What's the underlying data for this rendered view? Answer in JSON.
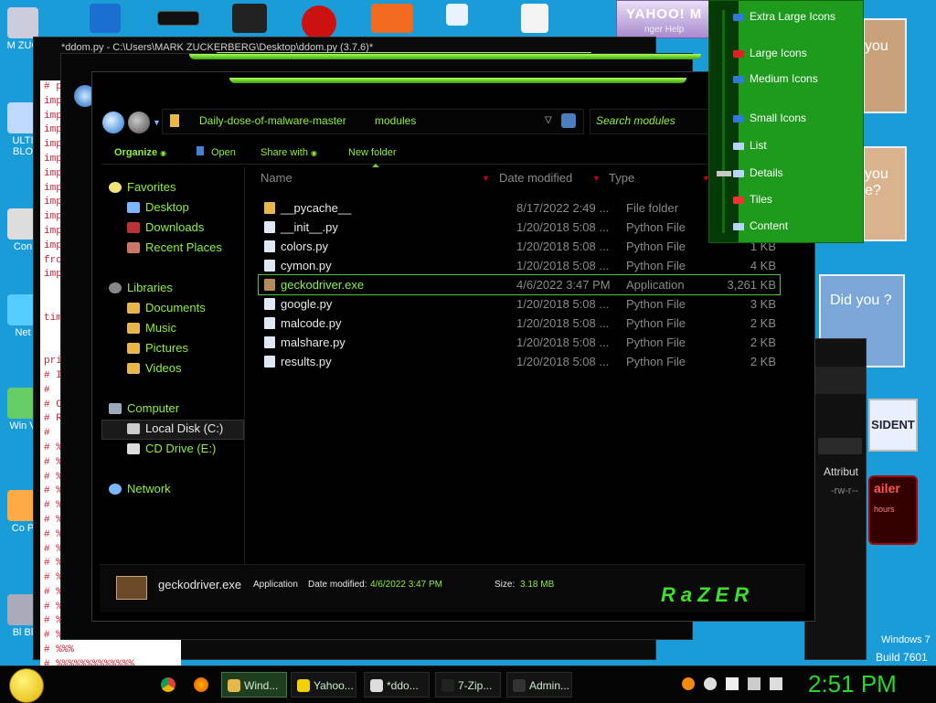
{
  "desktop": {
    "icons": [
      {
        "label": "M ZUC",
        "color": "#ccd"
      },
      {
        "label": "ULTI BLO",
        "color": "#bfd8ff"
      },
      {
        "label": "Con",
        "color": "#ddd"
      },
      {
        "label": "Net",
        "color": "#5cf"
      },
      {
        "label": "Win V",
        "color": "#6c6"
      },
      {
        "label": "Co P",
        "color": "#fa4"
      },
      {
        "label": "Bl Bl",
        "color": "#aab"
      }
    ]
  },
  "code_window": {
    "title": "*ddom.py - C:\\Users\\MARK ZUCKERBERG\\Desktop\\ddom.py (3.7.6)*",
    "lines": [
      "# p",
      "imp",
      "imp",
      "imp",
      "imp",
      "imp",
      "imp",
      "imp",
      "imp",
      "imp",
      "imp",
      "imp",
      "fro",
      "imp",
      "",
      "",
      "tim",
      "",
      "",
      "pri",
      "# I",
      "#",
      "# C",
      "# R",
      "#",
      "# %",
      "# %",
      "# %",
      "# %",
      "# %",
      "# %",
      "# %",
      "# %",
      "# %",
      "# %",
      "# %",
      "# %",
      "# %",
      "# %%%%",
      "# %%%",
      "# %%%%%%%%%%%%%",
      "# %%%%%%%%%%%%%%"
    ]
  },
  "yahoo": {
    "header": "YAHOO! M",
    "sub": "nger  Help"
  },
  "side_tiles": [
    {
      "text": "you",
      "bg": "#c9a27c"
    },
    {
      "text": "you e?",
      "bg": "#d9b28e"
    },
    {
      "text": "Did you ?",
      "bg": "#7aa6d8"
    },
    {
      "text": "SIDENT",
      "bg": "#e8f0ff"
    },
    {
      "text": "ailer",
      "sub": "hours",
      "bg": "#300"
    }
  ],
  "props_panel": {
    "header": "Attribut",
    "value": "-rw-r--"
  },
  "explorer": {
    "breadcrumb": [
      "Daily-dose-of-malware-master",
      "modules"
    ],
    "search_placeholder": "Search modules",
    "toolbar": {
      "organize": "Organize",
      "open": "Open",
      "share": "Share with",
      "new_folder": "New folder"
    },
    "nav": {
      "favorites": "Favorites",
      "favorites_items": [
        "Desktop",
        "Downloads",
        "Recent Places"
      ],
      "libraries": "Libraries",
      "libraries_items": [
        "Documents",
        "Music",
        "Pictures",
        "Videos"
      ],
      "computer": "Computer",
      "computer_items": [
        "Local Disk (C:)",
        "CD Drive (E:)"
      ],
      "network": "Network"
    },
    "columns": {
      "name": "Name",
      "date": "Date modified",
      "type": "Type",
      "size": ""
    },
    "files": [
      {
        "name": "__pycache__",
        "date": "8/17/2022 2:49 ...",
        "type": "File folder",
        "size": "",
        "icon": "#e7b74a"
      },
      {
        "name": "__init__.py",
        "date": "1/20/2018 5:08 ...",
        "type": "Python File",
        "size": "",
        "icon": "#dfe8f7"
      },
      {
        "name": "colors.py",
        "date": "1/20/2018 5:08 ...",
        "type": "Python File",
        "size": "1 KB",
        "icon": "#dfe8f7"
      },
      {
        "name": "cymon.py",
        "date": "1/20/2018 5:08 ...",
        "type": "Python File",
        "size": "4 KB",
        "icon": "#dfe8f7"
      },
      {
        "name": "geckodriver.exe",
        "date": "4/6/2022 3:47 PM",
        "type": "Application",
        "size": "3,261 KB",
        "icon": "#b58b5c"
      },
      {
        "name": "google.py",
        "date": "1/20/2018 5:08 ...",
        "type": "Python File",
        "size": "3 KB",
        "icon": "#dfe8f7"
      },
      {
        "name": "malcode.py",
        "date": "1/20/2018 5:08 ...",
        "type": "Python File",
        "size": "2 KB",
        "icon": "#dfe8f7"
      },
      {
        "name": "malshare.py",
        "date": "1/20/2018 5:08 ...",
        "type": "Python File",
        "size": "2 KB",
        "icon": "#dfe8f7"
      },
      {
        "name": "results.py",
        "date": "1/20/2018 5:08 ...",
        "type": "Python File",
        "size": "2 KB",
        "icon": "#dfe8f7"
      }
    ],
    "selected_index": 4,
    "details": {
      "filename": "geckodriver.exe",
      "kind": "Application",
      "date_label": "Date modified:",
      "date_value": "4/6/2022 3:47 PM",
      "size_label": "Size:",
      "size_value": "3.18 MB",
      "logo": "RaZER"
    }
  },
  "view_menu": {
    "options": [
      "Extra Large Icons",
      "Large Icons",
      "Medium Icons",
      "Small Icons",
      "List",
      "Details",
      "Tiles",
      "Content"
    ]
  },
  "os_watermark": {
    "line1": "Windows 7",
    "line2": "Build 7601"
  },
  "taskbar": {
    "buttons": [
      "Wind...",
      "Yahoo...",
      "*ddo...",
      "7-Zip...",
      "Admin..."
    ],
    "clock": "2:51 PM"
  },
  "colors": {
    "accent": "#8eef3c",
    "selection": "#4fc43a",
    "menu_green": "#1e9b1c",
    "desktop": "#1a9cd9"
  }
}
